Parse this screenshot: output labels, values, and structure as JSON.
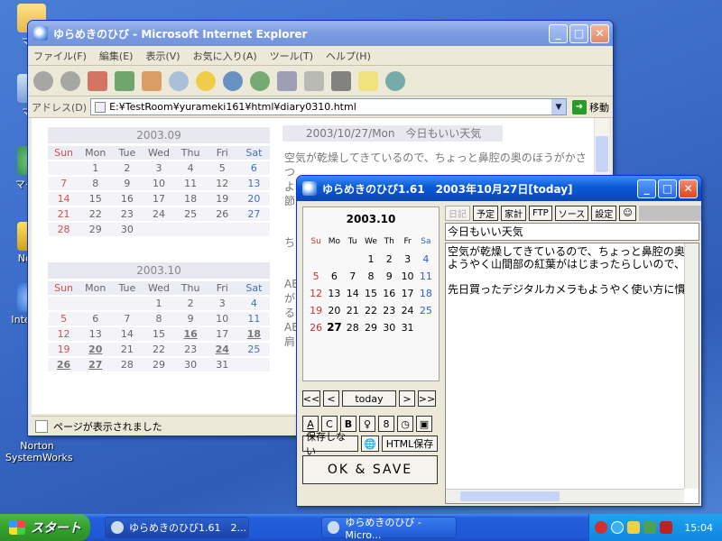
{
  "desktop": {
    "icons": [
      {
        "label": "マイ"
      },
      {
        "label": "マイ"
      },
      {
        "label": "マイ ネ"
      },
      {
        "label": "Norto"
      },
      {
        "label": "Inte Exp"
      },
      {
        "label": "Norton SystemWorks"
      }
    ]
  },
  "ie": {
    "title": "ゆらめきのひび - Microsoft Internet Explorer",
    "menu": [
      "ファイル(F)",
      "編集(E)",
      "表示(V)",
      "お気に入り(A)",
      "ツール(T)",
      "ヘルプ(H)"
    ],
    "address_label": "アドレス(D)",
    "address_value": "E:¥TestRoom¥yurameki161¥html¥diary0310.html",
    "go_label": "移動",
    "status_text": "ページが表示されました",
    "content": {
      "cal1_title": "2003.09",
      "cal2_title": "2003.10",
      "weekdays": [
        "Sun",
        "Mon",
        "Tue",
        "Wed",
        "Thu",
        "Fri",
        "Sat"
      ],
      "cal1_days": [
        "",
        "1",
        "2",
        "3",
        "4",
        "5",
        "6",
        "7",
        "8",
        "9",
        "10",
        "11",
        "12",
        "13",
        "14",
        "15",
        "16",
        "17",
        "18",
        "19",
        "20",
        "21",
        "22",
        "23",
        "24",
        "25",
        "26",
        "27",
        "28",
        "29",
        "30",
        "",
        "",
        "",
        ""
      ],
      "cal2_days": [
        "",
        "",
        "",
        "1",
        "2",
        "3",
        "4",
        "5",
        "6",
        "7",
        "8",
        "9",
        "10",
        "11",
        "12",
        "13",
        "14",
        "15",
        "16",
        "17",
        "18",
        "19",
        "20",
        "21",
        "22",
        "23",
        "24",
        "25",
        "26",
        "27",
        "28",
        "29",
        "30",
        "31",
        ""
      ],
      "diary_head": "2003/10/27/Mon　今日もいい天気",
      "diary_text": [
        "空気が乾燥してきているので、ちょっと鼻腔の奥のほうがかさつ",
        "よ",
        "節",
        "ち",
        "AE",
        "が",
        "る",
        "AE",
        "肩"
      ]
    }
  },
  "app": {
    "title": "ゆらめきのひび1.61　2003年10月27日[today]",
    "mini_cal_title": "2003.10",
    "weekdays": [
      "Su",
      "Mo",
      "Tu",
      "We",
      "Th",
      "Fr",
      "Sa"
    ],
    "days": [
      "",
      "",
      "",
      "1",
      "2",
      "3",
      "4",
      "5",
      "6",
      "7",
      "8",
      "9",
      "10",
      "11",
      "12",
      "13",
      "14",
      "15",
      "16",
      "17",
      "18",
      "19",
      "20",
      "21",
      "22",
      "23",
      "24",
      "25",
      "26",
      "27",
      "28",
      "29",
      "30",
      "31",
      ""
    ],
    "today_day": "27",
    "nav": {
      "first": "<<",
      "prev": "<",
      "today": "today",
      "next": ">",
      "last": ">>"
    },
    "format_buttons": [
      "A",
      "C",
      "B",
      "♀",
      "8",
      "◷",
      "▣"
    ],
    "save_no_label": "保存しない",
    "html_save_label": "HTML保存",
    "ok_label": "OK & SAVE",
    "toolbar": [
      "日記",
      "予定",
      "家計",
      "FTP",
      "ソース",
      "設定",
      "☺"
    ],
    "entry_title": "今日もいい天気",
    "entry_text": [
      "空気が乾燥してきているので、ちょっと鼻腔の奥のほ",
      "ようやく山間部の紅葉がはじまったらしいので、これか",
      "",
      "先日買ったデジタルカメラもようやく使い方に慣れてき"
    ]
  },
  "taskbar": {
    "start_label": "スタート",
    "tasks": [
      {
        "label": "ゆらめきのひび1.61　2..."
      },
      {
        "label": "ゆらめきのひび - Micro..."
      }
    ],
    "clock": "15:04"
  }
}
